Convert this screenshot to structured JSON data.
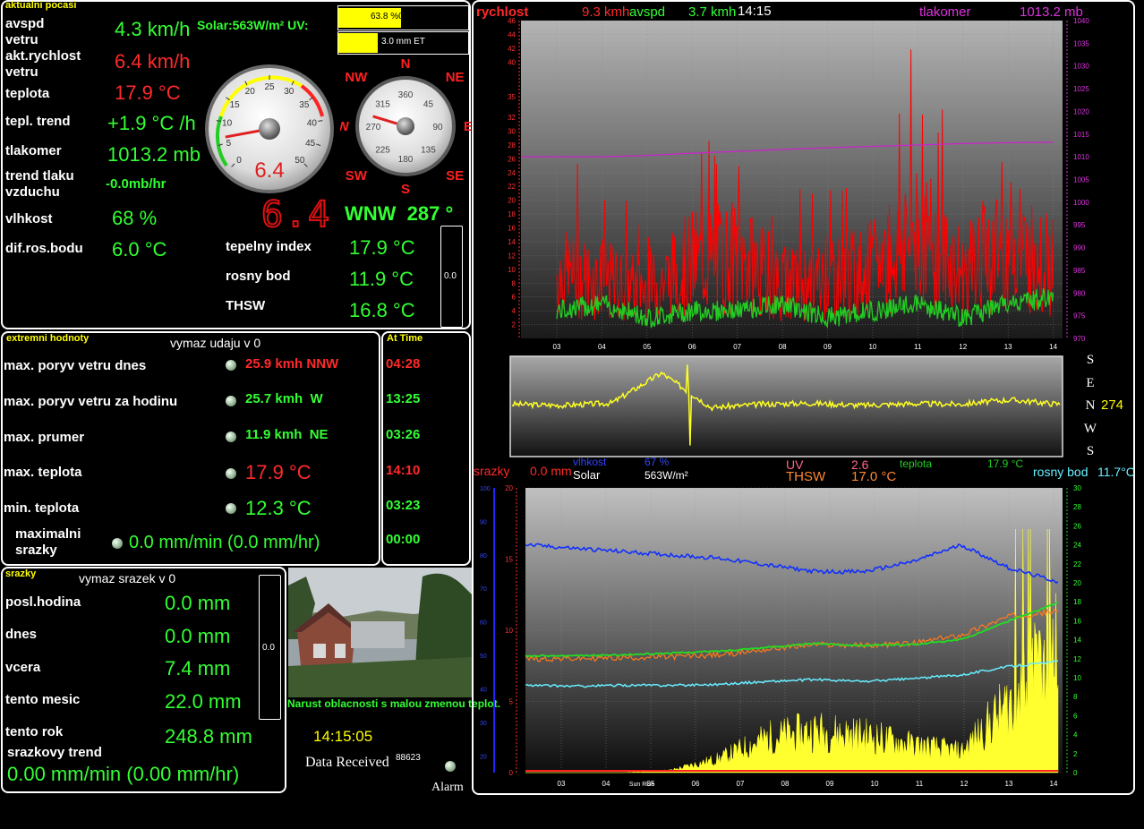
{
  "current": {
    "title": "aktualni pocasi",
    "solar_uv": "Solar:563W/m² UV:",
    "rows": [
      {
        "label": "avspd\nvetru",
        "value": "4.3 km/h"
      },
      {
        "label": "akt.rychlost\nvetru",
        "value": "6.4 km/h"
      },
      {
        "label": "teplota",
        "value": "17.9 °C"
      },
      {
        "label": "tepl. trend",
        "value": "+1.9 °C /h"
      },
      {
        "label": "tlakomer",
        "value": "1013.2 mb"
      },
      {
        "label": "trend tlaku\nvzduchu",
        "value": "-0.0mb/hr"
      },
      {
        "label": "vlhkost",
        "value": "68 %"
      },
      {
        "label": "dif.ros.bodu",
        "value": "6.0 °C"
      }
    ],
    "speed_gauge": {
      "readout": "6.4",
      "ticks": [
        "0",
        "5",
        "10",
        "15",
        "20",
        "25",
        "30",
        "35",
        "40",
        "45",
        "50"
      ],
      "value": 6.4
    },
    "compass": {
      "directions": [
        "N",
        "NE",
        "E",
        "SE",
        "S",
        "SW",
        "W",
        "NW"
      ],
      "ticks": [
        "360",
        "45",
        "90",
        "135",
        "180",
        "225",
        "270",
        "315"
      ],
      "bearing": 287
    },
    "digital_speed": "6.4",
    "wind_dir_text": "WNW  287 °",
    "solar_bar": {
      "label": "63.8 %00:32hrs",
      "fill": 0.48
    },
    "et_bar": {
      "label": "3.0 mm ET",
      "fill": 0.3
    },
    "heat_rows": [
      {
        "label": "tepelny index",
        "value": "17.9 °C"
      },
      {
        "label": "rosny bod",
        "value": "11.9 °C"
      },
      {
        "label": "THSW",
        "value": "16.8 °C"
      }
    ],
    "side_box_value": "0.0"
  },
  "extremes": {
    "title": "extremni hodnoty",
    "reset_label": "vymaz udaju v 0",
    "at_time_title": "At Time",
    "rows": [
      {
        "label": "max. poryv vetru dnes",
        "value": "25.9 kmh NNW",
        "color": "#ff2a2a",
        "time": "04:28",
        "time_color": "#ff2a2a"
      },
      {
        "label": "max. poryv vetru za hodinu",
        "value": "25.7 kmh  W",
        "color": "#33ff33",
        "time": "13:25",
        "time_color": "#33ff33"
      },
      {
        "label": "max. prumer",
        "value": "11.9 kmh  NE",
        "color": "#33ff33",
        "time": "03:26",
        "time_color": "#33ff33"
      },
      {
        "label": "max. teplota",
        "value": "17.9 °C",
        "color": "#ff2a2a",
        "time": "14:10",
        "time_color": "#ff2a2a"
      },
      {
        "label": "min. teplota",
        "value": "12.3 °C",
        "color": "#33ff33",
        "time": "03:23",
        "time_color": "#33ff33"
      },
      {
        "label": "maximalni\nsrazky",
        "value": "0.0 mm/min (0.0 mm/hr)",
        "color": "#33ff33",
        "time": "00:00",
        "time_color": "#33ff33"
      }
    ]
  },
  "rain": {
    "title": "srazky",
    "reset_label": "vymaz srazek v 0",
    "rows": [
      {
        "label": "posl.hodina",
        "value": "0.0 mm"
      },
      {
        "label": "dnes",
        "value": "0.0 mm"
      },
      {
        "label": "vcera",
        "value": "7.4 mm"
      },
      {
        "label": "tento mesic",
        "value": "22.0 mm"
      },
      {
        "label": "tento rok",
        "value": "248.8 mm"
      }
    ],
    "trend_label": "srazkovy trend",
    "trend_value": "0.00 mm/min (0.00 mm/hr)",
    "side_box_value": "0.0"
  },
  "forecast": "Narust oblacnosti s malou zmenou teplot.",
  "clock": "14:15:05",
  "data_received_label": "Data Received",
  "data_received_count": "88623",
  "alarm_label": "Alarm",
  "top_chart": {
    "legend": {
      "rychlost_label": "rychlost",
      "rychlost_value": "9.3 kmh",
      "avspd_label": "avspd",
      "avspd_value": "3.7 kmh",
      "time": "14:15",
      "tlakomer_label": "tlakomer",
      "tlakomer_value": "1013.2 mb"
    },
    "colors": {
      "gust": "#ff0000",
      "avg": "#22cc22",
      "pressure": "#cc22cc"
    }
  },
  "dir_chart": {
    "letters": [
      "S",
      "E",
      "N",
      "W",
      "S"
    ],
    "value": "274"
  },
  "bottom_chart": {
    "legend": {
      "srazky_label": "srazky",
      "srazky_value": "0.0 mm",
      "vlhkost_label": "vlhkost",
      "vlhkost_value": "67 %",
      "solar_label": "Solar",
      "solar_value": "563W/m²",
      "uv_label": "UV",
      "uv_value": "2.6",
      "thsw_label": "THSW",
      "thsw_value": "17.0 °C",
      "teplota_label": "teplota",
      "teplota_value": "17.9 °C",
      "rosny_label": "rosny bod",
      "rosny_value": "11.7°C"
    },
    "sunrise_label": "Sun Rise"
  },
  "chart_data": [
    {
      "type": "line",
      "title": "",
      "x": [
        "03",
        "04",
        "05",
        "06",
        "07",
        "08",
        "09",
        "10",
        "11",
        "12",
        "13",
        "14"
      ],
      "y_left_ticks": [
        "2",
        "4",
        "6",
        "8",
        "10",
        "12",
        "14",
        "16",
        "18",
        "20",
        "22",
        "24",
        "26",
        "28",
        "30",
        "32",
        "35",
        "40",
        "42",
        "44",
        "46"
      ],
      "y_right_ticks": [
        "970",
        "975",
        "980",
        "985",
        "990",
        "995",
        "1000",
        "1005",
        "1010",
        "1015",
        "1020",
        "1025",
        "1030",
        "1035",
        "1040"
      ],
      "ylim": [
        0,
        46
      ],
      "y2lim": [
        970,
        1040
      ],
      "series": [
        {
          "name": "rychlost",
          "axis": "left",
          "values": [
            11,
            10,
            8,
            13,
            14,
            9,
            10,
            12,
            18,
            11,
            16,
            12
          ]
        },
        {
          "name": "avspd",
          "axis": "left",
          "values": [
            4,
            5,
            3,
            4,
            4,
            5,
            3,
            4,
            5,
            3,
            5,
            6
          ]
        },
        {
          "name": "tlakomer",
          "axis": "right",
          "values": [
            1010,
            1010,
            1010.3,
            1010.8,
            1011.2,
            1011.6,
            1012,
            1012.3,
            1012.6,
            1012.9,
            1013.1,
            1013.2
          ]
        }
      ]
    },
    {
      "type": "line",
      "title": "",
      "x": [
        "03",
        "04",
        "05",
        "06",
        "07",
        "08",
        "09",
        "10",
        "11",
        "12",
        "13",
        "14"
      ],
      "series": [
        {
          "name": "smer vetru",
          "values": [
            274,
            272,
            276,
            330,
            268,
            274,
            276,
            272,
            275,
            274,
            282,
            274
          ]
        }
      ]
    },
    {
      "type": "area",
      "title": "",
      "x": [
        "03",
        "04",
        "05",
        "06",
        "07",
        "08",
        "09",
        "10",
        "11",
        "12",
        "13",
        "14"
      ],
      "y_left_ticks": [
        "0",
        "5",
        "10",
        "15",
        "20"
      ],
      "y_left2_ticks": [
        "20",
        "30",
        "40",
        "50",
        "60",
        "70",
        "80",
        "90",
        "100"
      ],
      "y_right_ticks": [
        "0",
        "2",
        "4",
        "6",
        "8",
        "10",
        "12",
        "14",
        "16",
        "18",
        "20",
        "22",
        "24",
        "26",
        "28",
        "30"
      ],
      "series": [
        {
          "name": "vlhkost",
          "values": [
            83,
            82,
            81,
            80,
            79,
            77,
            75,
            75,
            78,
            83,
            76,
            72
          ]
        },
        {
          "name": "Solar",
          "values": [
            0,
            0,
            0,
            10,
            60,
            150,
            180,
            160,
            120,
            90,
            300,
            563
          ]
        },
        {
          "name": "teplota",
          "values": [
            12.3,
            12.3,
            12.4,
            12.6,
            12.8,
            13.2,
            13.6,
            13.4,
            13.5,
            14.0,
            16.0,
            17.9
          ]
        },
        {
          "name": "rosny bod",
          "values": [
            9.2,
            9.1,
            9.2,
            9.2,
            9.3,
            9.6,
            9.8,
            9.6,
            9.9,
            10.3,
            11.2,
            11.7
          ]
        },
        {
          "name": "THSW",
          "values": [
            12.0,
            12.0,
            12.1,
            12.2,
            12.4,
            13.0,
            13.5,
            13.4,
            13.6,
            14.5,
            16.5,
            17.0
          ]
        },
        {
          "name": "srazky",
          "values": [
            0,
            0,
            0,
            0,
            0,
            0,
            0,
            0,
            0,
            0,
            0,
            0
          ]
        }
      ]
    }
  ]
}
